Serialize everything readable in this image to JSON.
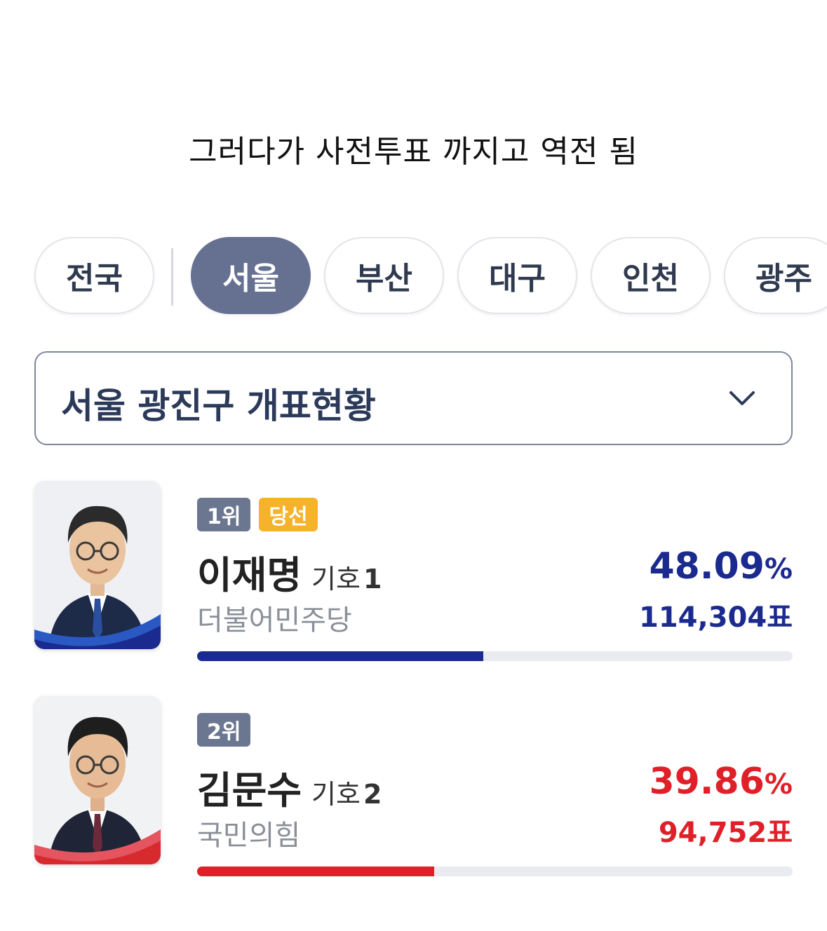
{
  "caption": "그러다가 사전투표 까지고 역전 됨",
  "region_tabs": [
    {
      "label": "전국",
      "active": false
    },
    {
      "label": "서울",
      "active": true
    },
    {
      "label": "부산",
      "active": false
    },
    {
      "label": "대구",
      "active": false
    },
    {
      "label": "인천",
      "active": false
    },
    {
      "label": "광주",
      "active": false
    }
  ],
  "district_select": {
    "label": "서울 광진구 개표현황",
    "icon": "chevron-down-icon"
  },
  "candidates": [
    {
      "rank": "1위",
      "winner_badge": "당선",
      "name": "이재명",
      "number_label": "기호",
      "number": "1",
      "party": "더불어민주당",
      "percent": "48.09",
      "percent_sign": "%",
      "votes": "114,304표",
      "share": 48.09,
      "color": "#1b2a8f",
      "accent": "#2b59c3"
    },
    {
      "rank": "2위",
      "name": "김문수",
      "number_label": "기호",
      "number": "2",
      "party": "국민의힘",
      "percent": "39.86",
      "percent_sign": "%",
      "votes": "94,752표",
      "share": 39.86,
      "color": "#e02028",
      "accent": "#d72a2f"
    }
  ]
}
